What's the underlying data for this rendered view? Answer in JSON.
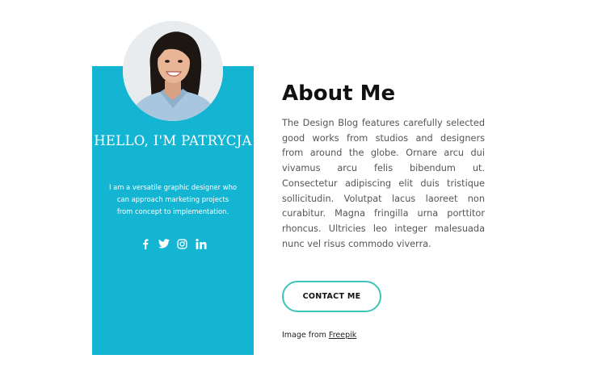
{
  "profile": {
    "greeting": "HELLO, I'M PATRYCJA",
    "bio": "I am a versatile graphic designer who can approach marketing projects from concept to implementation.",
    "photo_icon": "woman-portrait"
  },
  "socials": [
    {
      "icon": "facebook-icon"
    },
    {
      "icon": "twitter-icon"
    },
    {
      "icon": "instagram-icon"
    },
    {
      "icon": "linkedin-icon"
    }
  ],
  "about": {
    "title": "About Me",
    "description": "The Design Blog features carefully selected good works from studios and designers from around the globe. Ornare arcu dui vivamus arcu felis bibendum ut. Consectetur adipiscing elit duis tristique sollicitudin. Volutpat lacus laoreet non curabitur. Magna fringilla urna porttitor rhoncus. Ultricies leo integer malesuada nunc vel risus commodo viverra.",
    "button_label": "CONTACT ME",
    "credit_prefix": "Image from",
    "credit_link": "Freepik"
  },
  "colors": {
    "card": "#13b5d3",
    "button_border": "#3cc4ba",
    "heading": "#111111",
    "body_text": "#555555"
  }
}
